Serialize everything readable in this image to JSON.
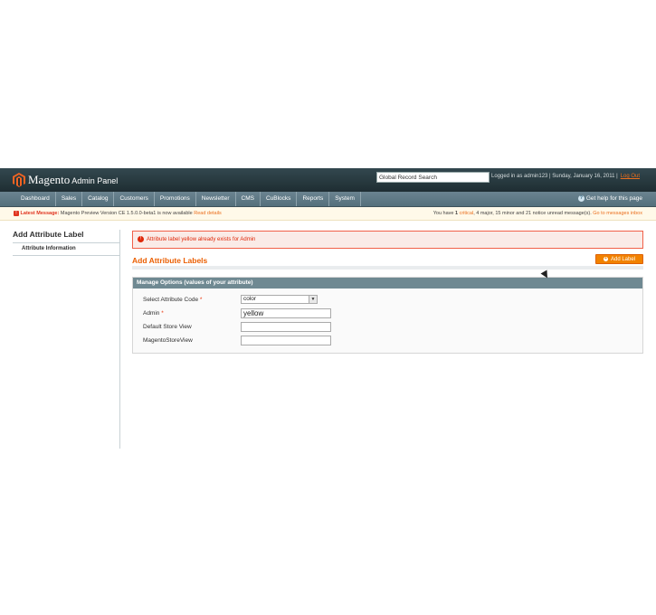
{
  "header": {
    "brand": "Magento",
    "subtitle": "Admin Panel",
    "search_value": "Global Record Search",
    "user_text": "Logged in as admin123 | Sunday, January 16, 2011 |",
    "logout": "Log Out"
  },
  "nav": {
    "items": [
      "Dashboard",
      "Sales",
      "Catalog",
      "Customers",
      "Promotions",
      "Newsletter",
      "CMS",
      "CuBlocks",
      "Reports",
      "System"
    ],
    "help": "Get help for this page"
  },
  "messages": {
    "label": "Latest Message:",
    "text": "Magento Preview Version CE 1.5.0.0-beta1 is now available",
    "link": "Read details",
    "summary_prefix": "You have",
    "critical_count": "1",
    "critical_link": "critical",
    "major_text": ", 4 major, 15 minor and 21 notice unread message(s).",
    "go_link": "Go to messages inbox"
  },
  "sidebar": {
    "title": "Add Attribute Label",
    "tab": "Attribute Information"
  },
  "main": {
    "error": "Attribute label yellow already exists for Admin",
    "section_title": "Add Attribute Labels",
    "add_button": "Add Label",
    "fieldset_title": "Manage Options (values of your attribute)",
    "fields": {
      "select_label": "Select Attribute Code",
      "select_value": "color",
      "admin_label": "Admin",
      "admin_value": "yellow",
      "default_label": "Default Store View",
      "default_value": "",
      "magento_label": "MagentoStoreView",
      "magento_value": ""
    }
  },
  "colors": {
    "accent": "#eb5e00",
    "header_bg": "#2a3b41",
    "nav_bg": "#607a86",
    "error": "#df280a"
  }
}
